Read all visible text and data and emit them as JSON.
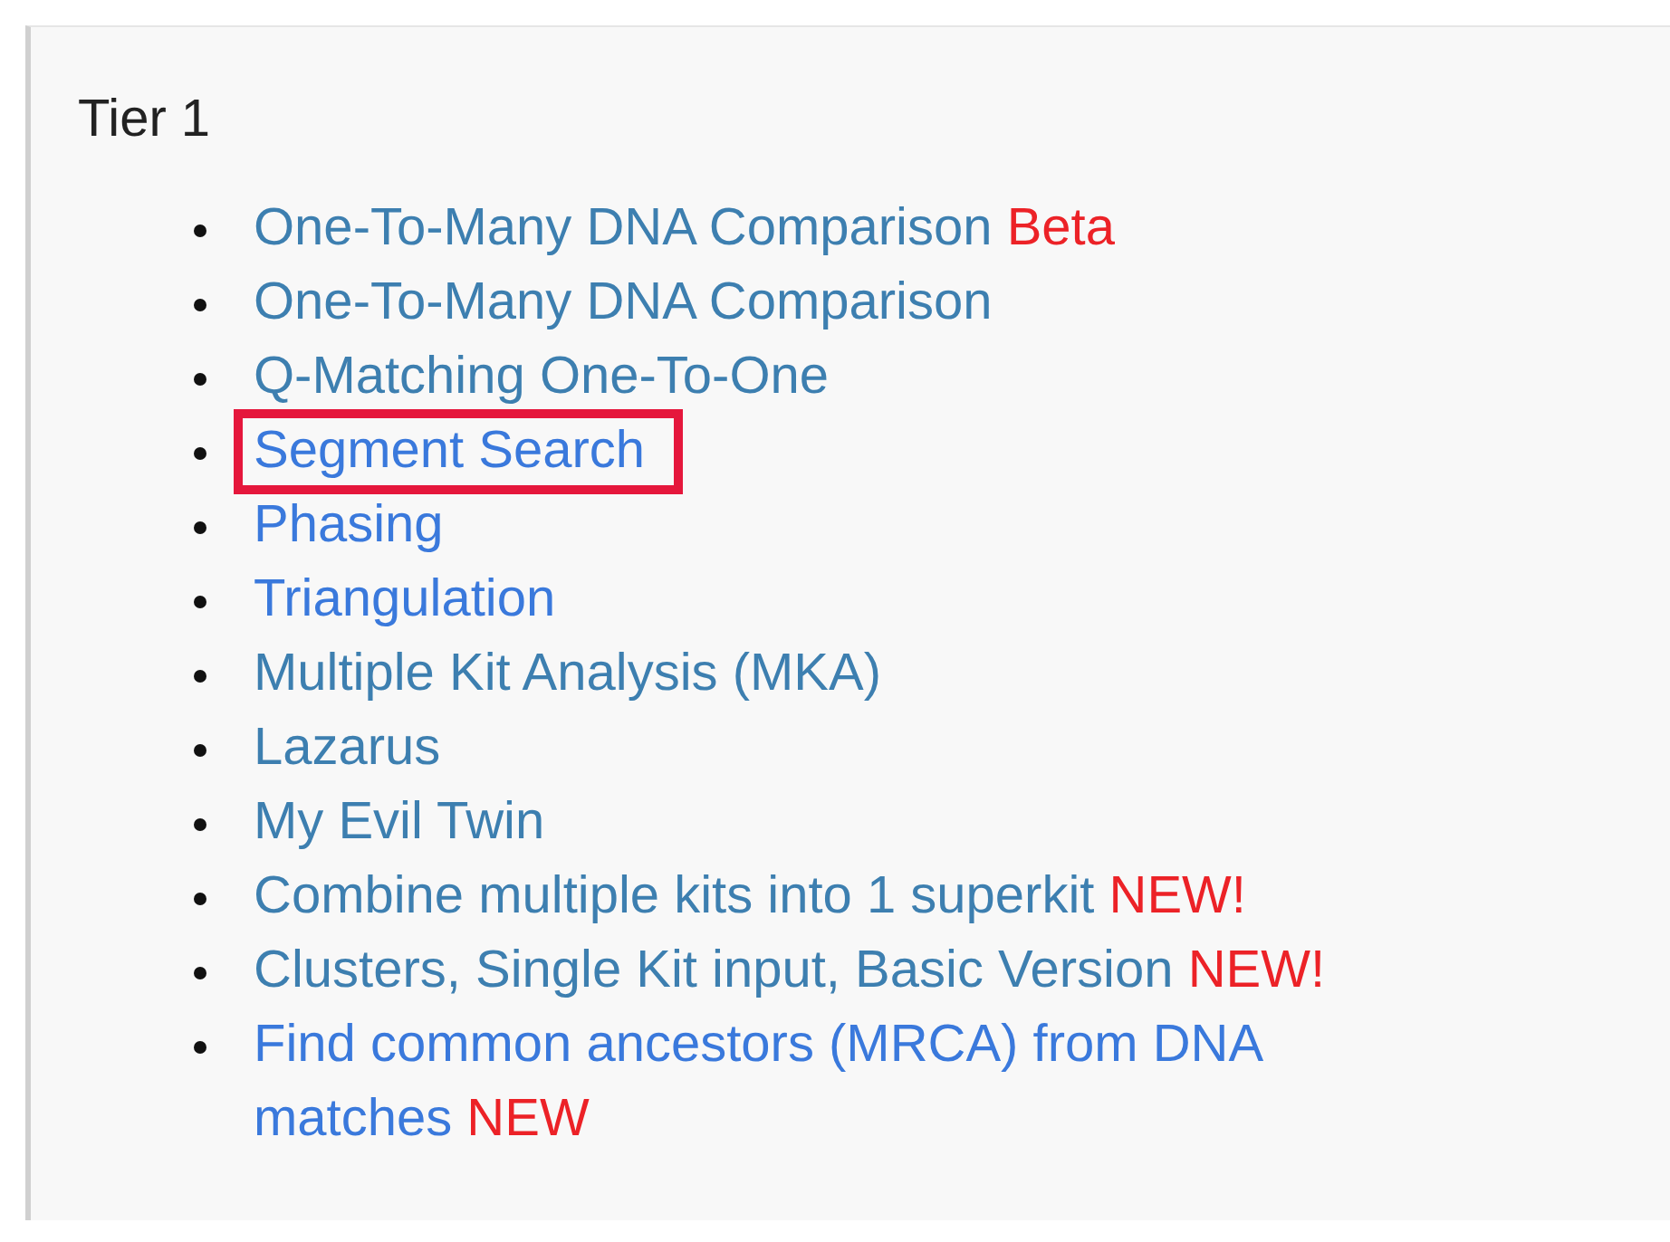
{
  "heading": "Tier 1",
  "links": [
    {
      "label": "One-To-Many DNA Comparison",
      "visited": true,
      "highlighted": false,
      "badge": "Beta"
    },
    {
      "label": "One-To-Many DNA Comparison",
      "visited": true,
      "highlighted": false
    },
    {
      "label": "Q-Matching One-To-One",
      "visited": true,
      "highlighted": false
    },
    {
      "label": "Segment Search",
      "visited": false,
      "highlighted": true
    },
    {
      "label": "Phasing",
      "visited": false,
      "highlighted": false
    },
    {
      "label": "Triangulation",
      "visited": false,
      "highlighted": false
    },
    {
      "label": "Multiple Kit Analysis (MKA)",
      "visited": true,
      "highlighted": false
    },
    {
      "label": "Lazarus",
      "visited": true,
      "highlighted": false
    },
    {
      "label": "My Evil Twin",
      "visited": true,
      "highlighted": false
    },
    {
      "label": "Combine multiple kits into 1 superkit",
      "visited": true,
      "highlighted": false,
      "badge": "NEW!"
    },
    {
      "label": "Clusters, Single Kit input, Basic Version",
      "visited": true,
      "highlighted": false,
      "badge": "NEW!"
    },
    {
      "label": "Find common ancestors (MRCA) from DNA matches",
      "visited": false,
      "highlighted": false,
      "badge": "NEW"
    }
  ]
}
